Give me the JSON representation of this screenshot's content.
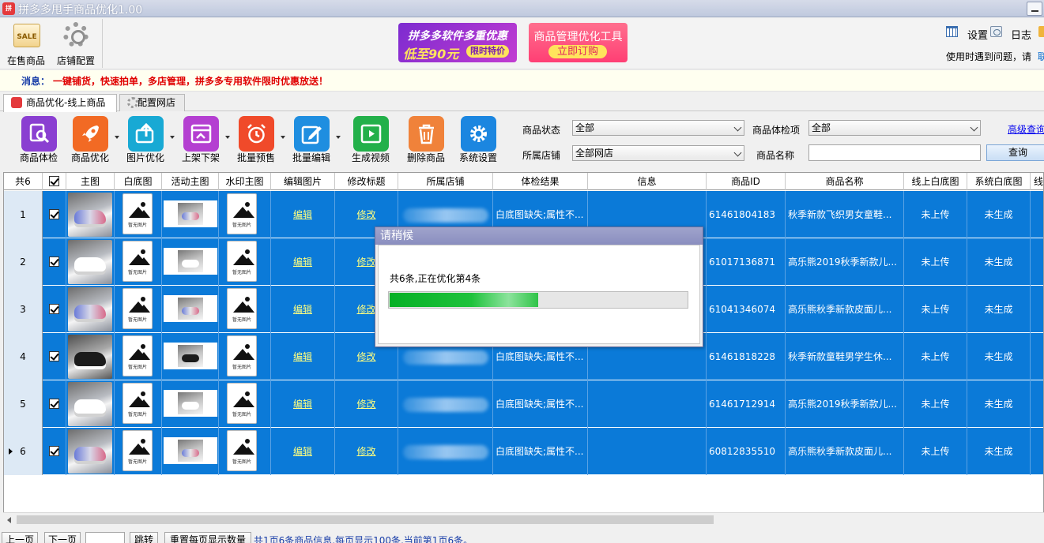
{
  "window": {
    "title": "拼多多甩手商品优化1.00"
  },
  "topbar": {
    "btn_on_sale": "在售商品",
    "btn_shop_config": "店铺配置",
    "banner1_line1": "拼多多软件多重优惠",
    "banner1_price": "低至90元",
    "banner1_tag": "限时特价",
    "banner2_line1": "商品管理优化工具",
    "banner2_btn": "立即订购",
    "settings": "设置",
    "log": "日志",
    "help_text": "使用时遇到问题，请",
    "help_link": "联"
  },
  "message": {
    "label": "消息：",
    "text": "一键铺货，快速拍单，多店管理，拼多多专用软件限时优惠放送！"
  },
  "tabs": [
    {
      "label": "商品优化-线上商品"
    },
    {
      "label": "配置网店"
    }
  ],
  "toolbar": {
    "buttons": [
      {
        "label": "商品体检",
        "color": "#8a3fd1"
      },
      {
        "label": "商品优化",
        "color": "#f26a24"
      },
      {
        "label": "图片优化",
        "color": "#18a9d4"
      },
      {
        "label": "上架下架",
        "color": "#b43fd1"
      },
      {
        "label": "批量预售",
        "color": "#f04a2a"
      },
      {
        "label": "批量编辑",
        "color": "#1f8ee0"
      },
      {
        "label": "生成视频",
        "color": "#23b04a"
      },
      {
        "label": "删除商品",
        "color": "#f0823a"
      },
      {
        "label": "系统设置",
        "color": "#1b86e0"
      }
    ]
  },
  "filters": {
    "status_label": "商品状态",
    "status_value": "全部",
    "check_label": "商品体检项",
    "check_value": "全部",
    "shop_label": "所属店铺",
    "shop_value": "全部网店",
    "name_label": "商品名称",
    "name_value": "",
    "advanced": "高级查询",
    "query": "查询"
  },
  "grid": {
    "count_header": "共6",
    "headers": [
      "主图",
      "白底图",
      "活动主图",
      "水印主图",
      "编辑图片",
      "修改标题",
      "所属店铺",
      "体检结果",
      "信息",
      "商品ID",
      "商品名称",
      "线上白底图",
      "系统白底图",
      "线"
    ],
    "no_image_text": "暂无图片",
    "rows": [
      {
        "num": "1",
        "edit": "编辑",
        "modify": "修改",
        "check": "白底图缺失;属性不...",
        "id": "61461804183",
        "name": "秋季新款飞织男女童鞋...",
        "online_white": "未上传",
        "sys_white": "未生成"
      },
      {
        "num": "2",
        "edit": "编辑",
        "modify": "修改",
        "check": "",
        "id": "61017136871",
        "name": "高乐熊2019秋季新款儿...",
        "online_white": "未上传",
        "sys_white": "未生成"
      },
      {
        "num": "3",
        "edit": "编辑",
        "modify": "修改",
        "check": "",
        "id": "61041346074",
        "name": "高乐熊秋季新款皮面儿...",
        "online_white": "未上传",
        "sys_white": "未生成"
      },
      {
        "num": "4",
        "edit": "编辑",
        "modify": "修改",
        "check": "白底图缺失;属性不...",
        "id": "61461818228",
        "name": "秋季新款童鞋男学生休...",
        "online_white": "未上传",
        "sys_white": "未生成"
      },
      {
        "num": "5",
        "edit": "编辑",
        "modify": "修改",
        "check": "白底图缺失;属性不...",
        "id": "61461712914",
        "name": "高乐熊2019秋季新款儿...",
        "online_white": "未上传",
        "sys_white": "未生成"
      },
      {
        "num": "6",
        "edit": "编辑",
        "modify": "修改",
        "check": "白底图缺失;属性不...",
        "id": "60812835510",
        "name": "高乐熊秋季新款皮面儿...",
        "online_white": "未上传",
        "sys_white": "未生成"
      }
    ]
  },
  "pager": {
    "prev": "上一页",
    "next": "下一页",
    "jump": "跳转",
    "reset": "重置每页显示数量",
    "info": "共1页6条商品信息,每页显示100条,当前第1页6条。"
  },
  "modal": {
    "title": "请稍候",
    "text": "共6条,正在优化第4条",
    "progress": 0.5
  }
}
